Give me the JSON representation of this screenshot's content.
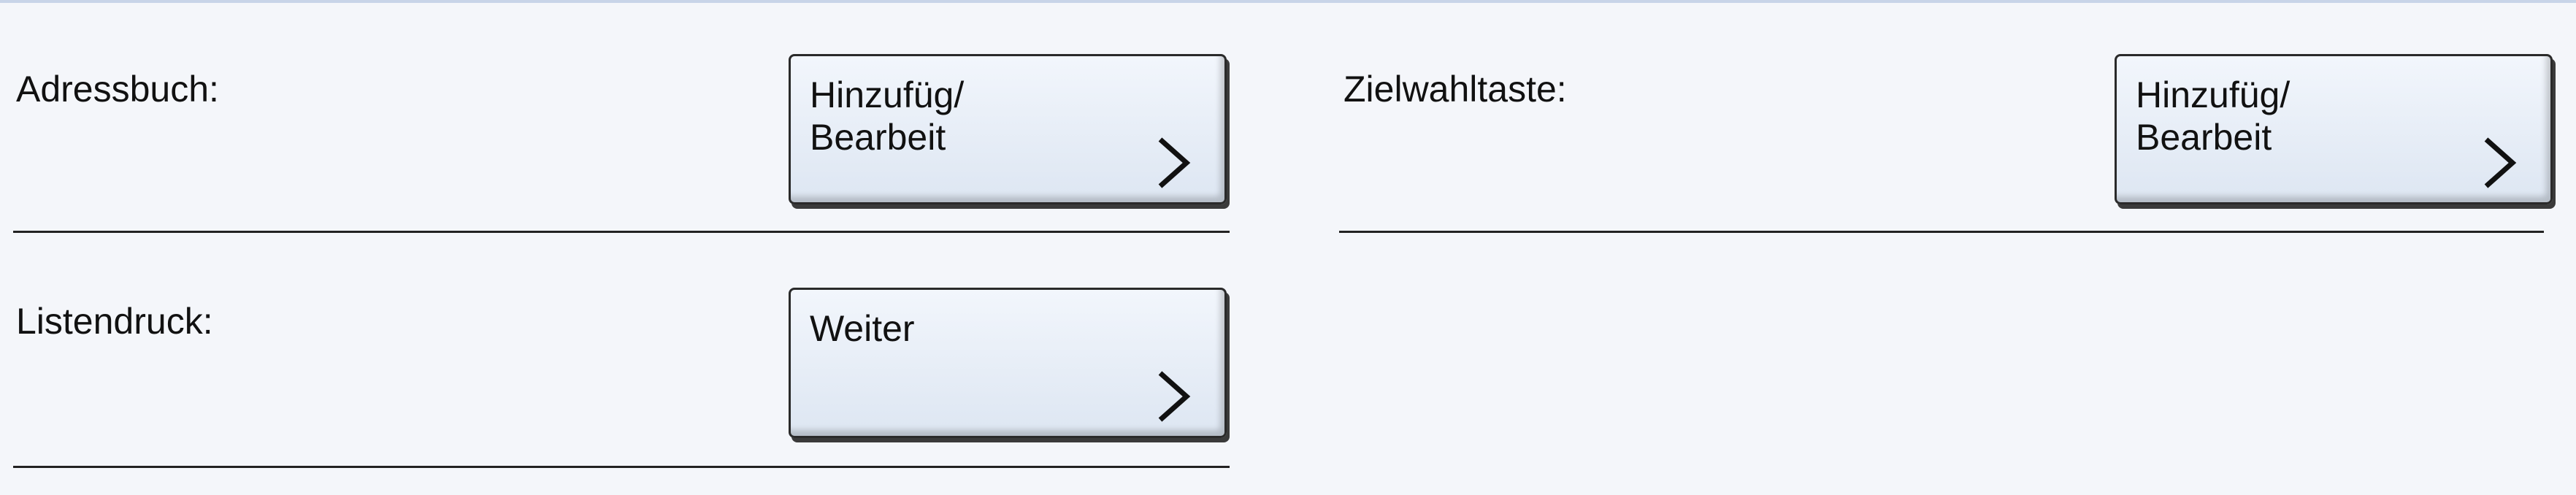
{
  "rows": [
    {
      "label": "Adressbuch:",
      "button": "Hinzufüg/\nBearbeit"
    },
    {
      "label": "Zielwahltaste:",
      "button": "Hinzufüg/\nBearbeit"
    },
    {
      "label": "Listendruck:",
      "button": "Weiter"
    }
  ],
  "icons": {
    "button_arrow": "chevron-right-icon"
  }
}
